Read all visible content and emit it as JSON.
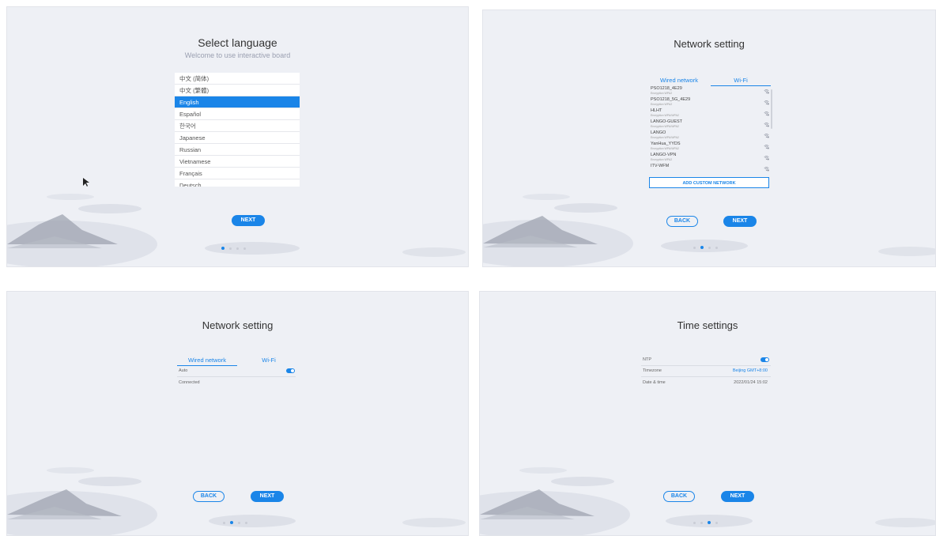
{
  "colors": {
    "accent": "#1a85e8",
    "background": "#eef0f5"
  },
  "screens": {
    "language": {
      "title": "Select language",
      "subtitle": "Welcome to use interactive board",
      "languages": [
        "中文 (简体)",
        "中文 (繁體)",
        "English",
        "Español",
        "한국어",
        "Japanese",
        "Russian",
        "Vietnamese",
        "Français",
        "Deutsch"
      ],
      "selected": "English",
      "next_label": "NEXT",
      "page_indicator": {
        "current": 1,
        "total": 4
      }
    },
    "wifi": {
      "title": "Network setting",
      "tabs": [
        "Wired network",
        "Wi-Fi"
      ],
      "active_tab": "Wi-Fi",
      "networks": [
        {
          "name": "PSO1218_4E29",
          "encryption": "Encryption WPA2"
        },
        {
          "name": "PSO1218_5G_4E29",
          "encryption": "Encryption WPA2"
        },
        {
          "name": "HLHT",
          "encryption": "Encryption WPA/WPA2"
        },
        {
          "name": "LANGO-GUEST",
          "encryption": "Encryption WPA/WPA2"
        },
        {
          "name": "LANGO",
          "encryption": "Encryption WPA/WPA2"
        },
        {
          "name": "YanHua_YYDS",
          "encryption": "Encryption WPA/WPA2"
        },
        {
          "name": "LANGO-VPN",
          "encryption": "Encryption WPA2"
        },
        {
          "name": "ITV-WFM",
          "encryption": ""
        }
      ],
      "add_network_label": "ADD CUSTOM NETWORK",
      "back_label": "BACK",
      "next_label": "NEXT",
      "page_indicator": {
        "current": 2,
        "total": 4
      }
    },
    "wired": {
      "title": "Network setting",
      "tabs": [
        "Wired network",
        "Wi-Fi"
      ],
      "active_tab": "Wired network",
      "auto_label": "Auto",
      "auto_enabled": true,
      "status": "Connected",
      "back_label": "BACK",
      "next_label": "NEXT",
      "page_indicator": {
        "current": 2,
        "total": 4
      }
    },
    "time": {
      "title": "Time settings",
      "ntp_label": "NTP",
      "ntp_enabled": true,
      "timezone_label": "Timezone",
      "timezone_value": "Beijing GMT+8:00",
      "datetime_label": "Date & time",
      "datetime_value": "2022/01/24 15:02",
      "back_label": "BACK",
      "next_label": "NEXT",
      "page_indicator": {
        "current": 3,
        "total": 4
      }
    }
  }
}
